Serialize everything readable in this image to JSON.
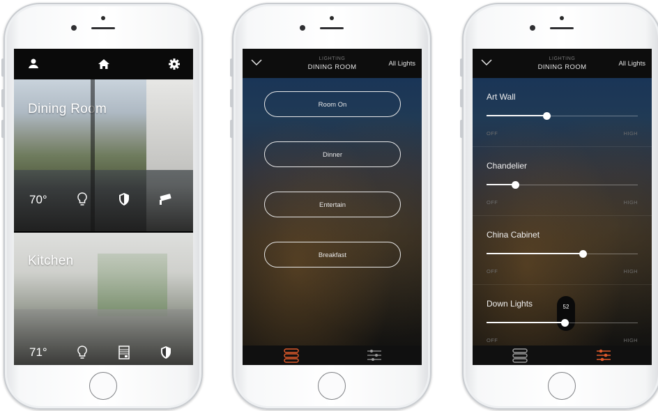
{
  "home": {
    "rooms": [
      {
        "name": "Dining Room",
        "temperature": "70°"
      },
      {
        "name": "Kitchen",
        "temperature": "71°"
      }
    ]
  },
  "scenes": {
    "header": {
      "subtitle": "LIGHTING",
      "title": "DINING ROOM",
      "all_lights": "All Lights"
    },
    "buttons": [
      "Room On",
      "Dinner",
      "Entertain",
      "Breakfast"
    ]
  },
  "sliders": {
    "header": {
      "subtitle": "LIGHTING",
      "title": "DINING ROOM",
      "all_lights": "All Lights"
    },
    "off_label": "OFF",
    "high_label": "HIGH",
    "lights": [
      {
        "name": "Art Wall",
        "level": 40
      },
      {
        "name": "Chandelier",
        "level": 19
      },
      {
        "name": "China Cabinet",
        "level": 64
      },
      {
        "name": "Down Lights",
        "level": 52,
        "tooltip": "52"
      }
    ]
  },
  "colors": {
    "accent": "#e05a2b",
    "tab_inactive": "#9a9a9a"
  }
}
